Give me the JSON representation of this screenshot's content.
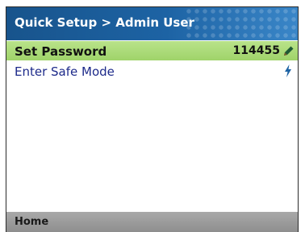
{
  "header": {
    "title": "Quick Setup > Admin User"
  },
  "menu": {
    "items": [
      {
        "label": "Set Password",
        "value": "114455",
        "icon": "pencil-icon"
      },
      {
        "label": "Enter Safe Mode",
        "value": "",
        "icon": "lightning-bolt-icon"
      }
    ]
  },
  "footer": {
    "left_label": "Home"
  },
  "colors": {
    "title_bar": "#1d63a4",
    "selected_row": "#a8d878",
    "item_text": "#1d2a8a",
    "footer_bar": "#9a9a9a"
  }
}
